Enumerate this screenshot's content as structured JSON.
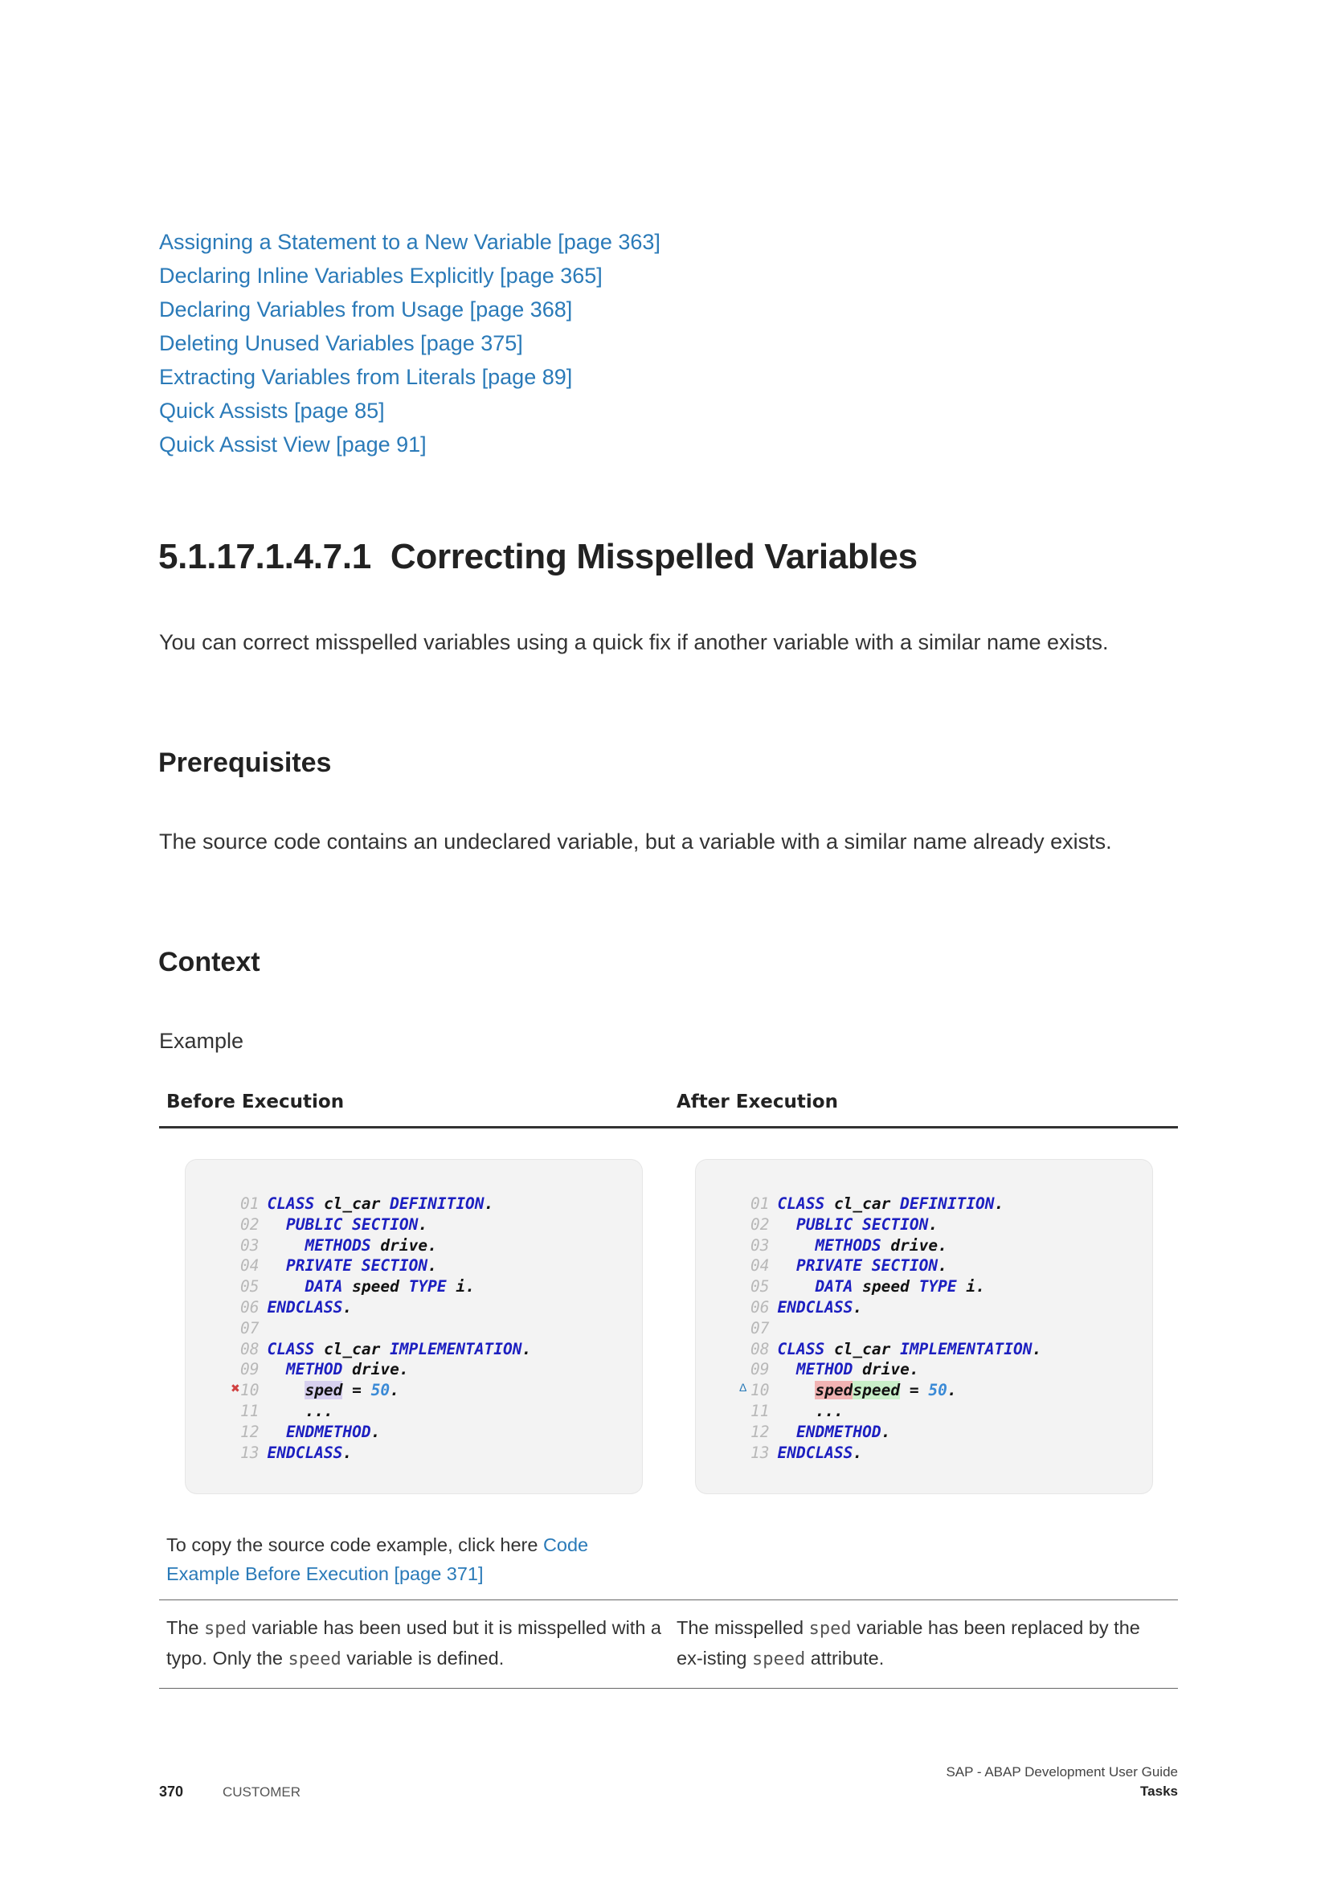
{
  "related_links": [
    "Assigning a Statement to a New Variable [page 363]",
    "Declaring Inline Variables Explicitly [page 365]",
    "Declaring Variables from Usage [page 368]",
    "Deleting Unused Variables [page 375]",
    "Extracting Variables from Literals [page 89]",
    "Quick Assists [page 85]",
    "Quick Assist View [page 91]"
  ],
  "section": {
    "number": "5.1.17.1.4.7.1",
    "title": "Correcting Misspelled Variables",
    "intro": "You can correct misspelled variables using a quick fix if another variable with a similar name exists."
  },
  "prerequisites": {
    "heading": "Prerequisites",
    "text": "The source code contains an undeclared variable, but a variable with a similar name already exists."
  },
  "context": {
    "heading": "Context",
    "example_label": "Example"
  },
  "table": {
    "col_before": "Before Execution",
    "col_after": "After Execution",
    "copy_text": "To copy the source code example, click here ",
    "copy_link": "Code Example Before Execution [page 371]",
    "before_desc_1": "The ",
    "before_var": "sped",
    "before_desc_2": " variable has been used but it is misspelled with a typo. Only the ",
    "before_var2": "speed",
    "before_desc_3": " variable is defined.",
    "after_desc_1": "The misspelled ",
    "after_var": "sped",
    "after_desc_2": " variable has been replaced by the ex-isting ",
    "after_var2": "speed",
    "after_desc_3": " attribute."
  },
  "code": {
    "line_numbers": [
      "01",
      "02",
      "03",
      "04",
      "05",
      "06",
      "07",
      "08",
      "09",
      "10",
      "11",
      "12",
      "13"
    ],
    "l01_kw1": "CLASS",
    "l01_name": "cl_car",
    "l01_kw2": "DEFINITION",
    "l02_kw": "PUBLIC SECTION",
    "l03_kw": "METHODS",
    "l03_name": "drive",
    "l04_kw": "PRIVATE SECTION",
    "l05_kw1": "DATA",
    "l05_name": "speed",
    "l05_kw2": "TYPE",
    "l05_type": "i",
    "l06_kw": "ENDCLASS",
    "l08_kw1": "CLASS",
    "l08_name": "cl_car",
    "l08_kw2": "IMPLEMENTATION",
    "l09_kw": "METHOD",
    "l09_name": "drive",
    "l10_before_var": "sped",
    "l10_after_old": "sped",
    "l10_after_new": "speed",
    "l10_rest": " = ",
    "l10_num": "50",
    "l11": "...",
    "l12_kw": "ENDMETHOD",
    "l13_kw": "ENDCLASS"
  },
  "footer": {
    "page": "370",
    "classification": "CUSTOMER",
    "doc_title": "SAP - ABAP Development User Guide",
    "chapter": "Tasks"
  }
}
